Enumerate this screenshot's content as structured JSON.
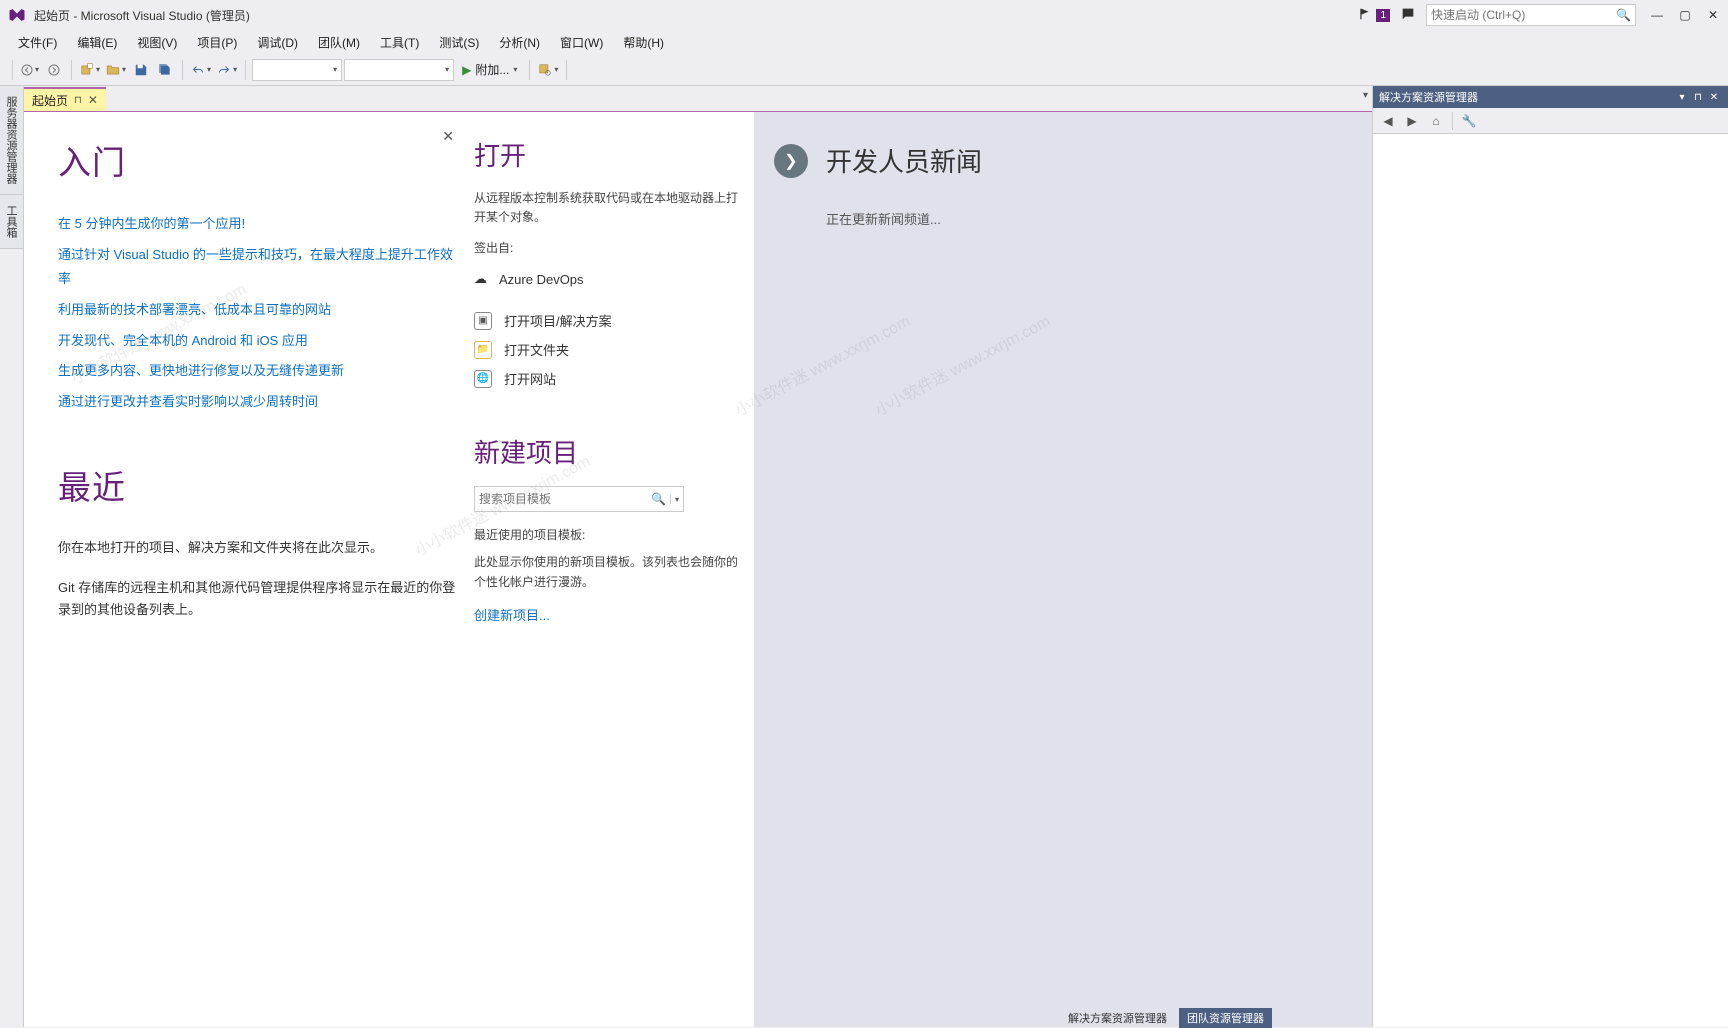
{
  "window": {
    "title": "起始页 - Microsoft Visual Studio (管理员)",
    "notification_count": "1",
    "quicklaunch_placeholder": "快速启动 (Ctrl+Q)"
  },
  "menubar": {
    "items": [
      "文件(F)",
      "编辑(E)",
      "视图(V)",
      "项目(P)",
      "调试(D)",
      "团队(M)",
      "工具(T)",
      "测试(S)",
      "分析(N)",
      "窗口(W)",
      "帮助(H)"
    ]
  },
  "toolbar": {
    "start_label": "附加..."
  },
  "left_tabs": [
    "服务器资源管理器",
    "工具箱"
  ],
  "doc_tab": {
    "label": "起始页"
  },
  "start_page": {
    "getting_started": {
      "heading": "入门",
      "links": [
        "在 5 分钟内生成你的第一个应用!",
        "通过针对 Visual Studio 的一些提示和技巧，在最大程度上提升工作效率",
        "利用最新的技术部署漂亮、低成本且可靠的网站",
        "开发现代、完全本机的 Android 和 iOS 应用",
        "生成更多内容、更快地进行修复以及无缝传递更新",
        "通过进行更改并查看实时影响以减少周转时间"
      ]
    },
    "recent": {
      "heading": "最近",
      "text1": "你在本地打开的项目、解决方案和文件夹将在此次显示。",
      "text2": "Git 存储库的远程主机和其他源代码管理提供程序将显示在最近的你登录到的其他设备列表上。"
    },
    "open": {
      "heading": "打开",
      "desc": "从远程版本控制系统获取代码或在本地驱动器上打开某个对象。",
      "checkout_label": "签出自:",
      "azure": "Azure DevOps",
      "items": [
        "打开项目/解决方案",
        "打开文件夹",
        "打开网站"
      ]
    },
    "new_project": {
      "heading": "新建项目",
      "search_placeholder": "搜索项目模板",
      "recent_label": "最近使用的项目模板:",
      "recent_text": "此处显示你使用的新项目模板。该列表也会随你的个性化帐户进行漫游。",
      "create_link": "创建新项目..."
    },
    "news": {
      "heading": "开发人员新闻",
      "loading": "正在更新新闻频道..."
    }
  },
  "solution_explorer": {
    "title": "解决方案资源管理器"
  },
  "bottom_tabs": {
    "a": "解决方案资源管理器",
    "b": "团队资源管理器"
  },
  "watermark": "小小软件迷 www.xxrjm.com"
}
